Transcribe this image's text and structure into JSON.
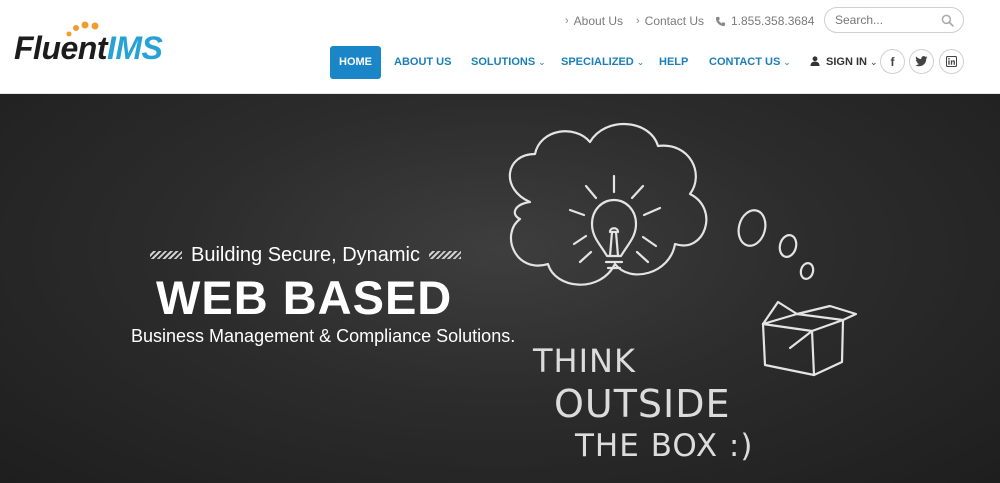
{
  "logo": {
    "part1": "Fluent",
    "part2": "IMS"
  },
  "toplinks": {
    "about": "About Us",
    "contact": "Contact Us",
    "phone": "1.855.358.3684"
  },
  "search": {
    "placeholder": "Search..."
  },
  "nav": {
    "home": "HOME",
    "about": "ABOUT US",
    "solutions": "SOLUTIONS",
    "specialized": "SPECIALIZED",
    "help": "HELP",
    "contact": "CONTACT US",
    "signin": "SIGN IN"
  },
  "social": {
    "facebook": "f",
    "twitter": "t",
    "linkedin": "in"
  },
  "hero": {
    "kicker": "Building Secure, Dynamic",
    "headline": "WEB BASED",
    "subline": "Business Management & Compliance Solutions.",
    "chalk_line1": "THINK",
    "chalk_line2": "OUTSIDE",
    "chalk_line3": "THE BOX :)"
  },
  "colors": {
    "accent": "#1a86c7",
    "link": "#1a7fb8",
    "logo_blue": "#26a2d6",
    "logo_dots": "#f39c2b"
  }
}
